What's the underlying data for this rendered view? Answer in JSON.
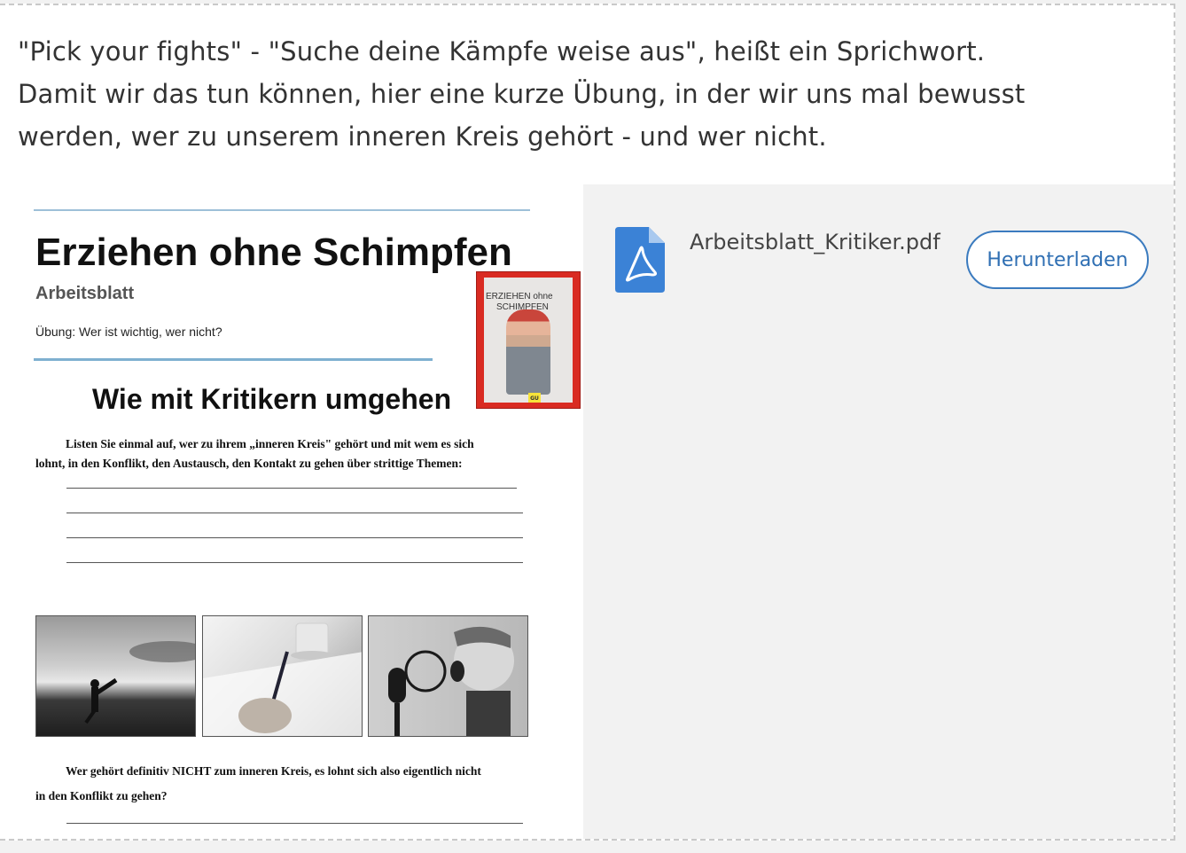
{
  "intro": {
    "line1": "\"Pick your fights\"  - \"Suche deine Kämpfe weise aus\", heißt ein Sprichwort.",
    "line2": "Damit wir das tun können, hier eine kurze Übung, in der wir uns mal bewusst",
    "line3": "werden, wer zu unserem inneren Kreis gehört - und wer nicht."
  },
  "document": {
    "title": "Erziehen ohne Schimpfen",
    "subtitle": "Arbeitsblatt",
    "task": "Übung: Wer ist wichtig, wer nicht?",
    "heading": "Wie mit Kritikern umgehen",
    "paragraph1_line1": "Listen Sie einmal auf, wer zu ihrem „inneren Kreis\" gehört und mit wem es sich",
    "paragraph1_line2": "lohnt, in den Konflikt, den Austausch, den Kontakt zu gehen über strittige Themen:",
    "paragraph2_line1": "Wer gehört definitiv NICHT zum inneren Kreis, es lohnt sich also eigentlich nicht",
    "paragraph2_line2": "in den Konflikt zu gehen?",
    "book": {
      "title_line1": "ERZIEHEN ohne",
      "title_line2": "SCHIMPFEN",
      "publisher": "GU"
    }
  },
  "attachment": {
    "filename": "Arbeitsblatt_Kritiker.pdf",
    "download_label": "Herunterladen",
    "icon": "pdf-file-icon",
    "accent_color": "#3b7bbf",
    "icon_color": "#3b82d6"
  }
}
